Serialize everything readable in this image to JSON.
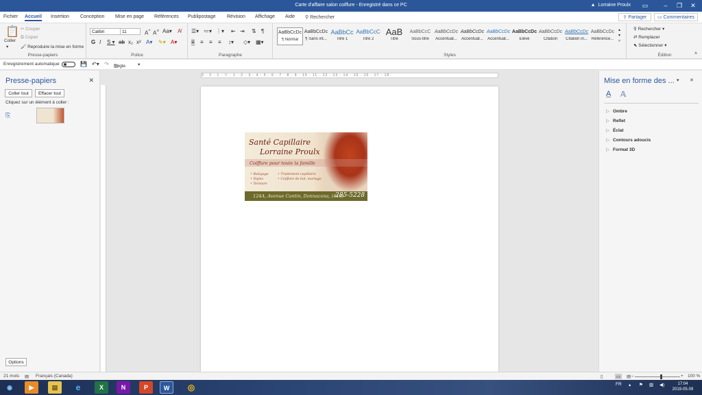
{
  "window": {
    "title": "Carte d'affaire salon coiffure  -  Enregistré dans ce PC",
    "user": "Lorraine Proulx",
    "minimize_icon": "minimize-icon",
    "restore_icon": "restore-icon",
    "close_icon": "close-icon"
  },
  "menu": {
    "tabs": [
      "Fichier",
      "Accueil",
      "Insertion",
      "Conception",
      "Mise en page",
      "Références",
      "Publipostage",
      "Révision",
      "Affichage",
      "Aide"
    ],
    "active_tab": "Accueil",
    "search_label": "Rechercher",
    "share_label": "Partager",
    "comments_label": "Commentaires"
  },
  "ribbon": {
    "clipboard": {
      "paste_label": "Coller",
      "cut_label": "Couper",
      "copy_label": "Copier",
      "format_painter_label": "Reproduire la mise en forme",
      "group_label": "Presse-papiers"
    },
    "font": {
      "font_name": "Calibri",
      "font_size": "11",
      "group_label": "Police"
    },
    "paragraph": {
      "group_label": "Paragraphe"
    },
    "styles": {
      "items": [
        {
          "preview": "AaBbCcDc",
          "name": "¶ Normal"
        },
        {
          "preview": "AaBbCcDc",
          "name": "¶ Sans int..."
        },
        {
          "preview": "AaBbCc",
          "name": "Titre 1"
        },
        {
          "preview": "AaBbCcC",
          "name": "Titre 2"
        },
        {
          "preview": "AaB",
          "name": "Titre"
        },
        {
          "preview": "AaBbCcC",
          "name": "Sous-titre"
        },
        {
          "preview": "AaBbCcDc",
          "name": "Accentuat..."
        },
        {
          "preview": "AaBbCcDc",
          "name": "Accentuat..."
        },
        {
          "preview": "AaBbCcDc",
          "name": "Accentuat..."
        },
        {
          "preview": "AaBbCcDc",
          "name": "Élevé"
        },
        {
          "preview": "AaBbCcDc",
          "name": "Citation"
        },
        {
          "preview": "AaBbCcDc",
          "name": "Citation in..."
        },
        {
          "preview": "AaBbCcDc",
          "name": "Référence..."
        }
      ],
      "group_label": "Styles"
    },
    "editing": {
      "find_label": "Rechercher",
      "replace_label": "Remplacer",
      "select_label": "Sélectionner",
      "group_label": "Édition"
    }
  },
  "qat": {
    "autosave_label": "Enregistrement automatique",
    "ruler_label": "Règle"
  },
  "clipboard_pane": {
    "title": "Presse-papiers",
    "paste_all_label": "Coller tout",
    "clear_all_label": "Effacer tout",
    "hint": "Cliquez sur un élément à coller :",
    "options_label": "Options"
  },
  "ruler": {
    "ticks": "3 · 2 · 1 · ▽ · 1 · 2 · 3 · 4 · 5 · 6 · 7 · 8 · 9 · 10 · 11 · 12 · 13 · 14 · 15 · 16 · 17 · 18"
  },
  "card": {
    "line1": "Santé Capillaire",
    "line2": "Lorraine Proulx",
    "tagline": "Coiffure pour toute la famille",
    "services_left": [
      "• Balayage",
      "• Styles",
      "• Teinture"
    ],
    "services_right": [
      "• Traitement capillaire",
      "• Coiffure de bal, mariage"
    ],
    "address": "124A, Avenue Cantin, Donnacona, (418)",
    "phone": "285-5228"
  },
  "format_pane": {
    "title": "Mise en forme des ...",
    "items": [
      "Ombre",
      "Reflet",
      "Éclat",
      "Contours adoucis",
      "Format 3D"
    ]
  },
  "status": {
    "words": "21 mots",
    "language": "Français (Canada)",
    "zoom": "100 %"
  },
  "taskbar": {
    "apps": [
      {
        "icon": "start-icon",
        "glyph": "◉"
      },
      {
        "icon": "media-player-icon",
        "glyph": "▶"
      },
      {
        "icon": "file-explorer-icon",
        "glyph": "▤"
      },
      {
        "icon": "internet-explorer-icon",
        "glyph": "e"
      },
      {
        "icon": "excel-icon",
        "glyph": "X"
      },
      {
        "icon": "onenote-icon",
        "glyph": "N"
      },
      {
        "icon": "powerpoint-icon",
        "glyph": "P"
      },
      {
        "icon": "word-icon",
        "glyph": "W"
      },
      {
        "icon": "chrome-icon",
        "glyph": "◎"
      }
    ],
    "lang": "FR",
    "time": "17:04",
    "date": "2019-05-09"
  }
}
